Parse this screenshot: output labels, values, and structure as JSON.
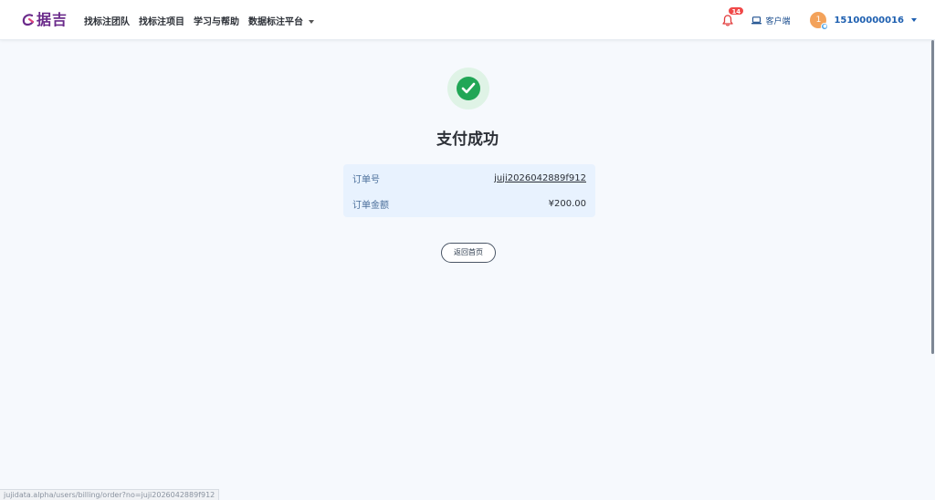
{
  "header": {
    "logo_text": "据吉",
    "nav": [
      {
        "label": "找标注团队"
      },
      {
        "label": "找标注项目"
      },
      {
        "label": "学习与帮助"
      },
      {
        "label": "数据标注平台"
      }
    ],
    "notifications_count": "14",
    "client_label": "客户端",
    "user": {
      "avatar_letter": "1",
      "phone": "15100000016"
    }
  },
  "main": {
    "title": "支付成功",
    "order": {
      "order_no_label": "订单号",
      "order_no_value": "juji2026042889f912",
      "amount_label": "订单金额",
      "amount_value": "¥200.00"
    },
    "home_button_label": "返回首页"
  },
  "status_bar": {
    "url": "jujidata.alpha/users/billing/order?no=juji2026042889f912"
  },
  "colors": {
    "brand": "#6a2a8a",
    "success": "#21a656",
    "link_blue": "#1d5fb0",
    "badge_red": "#f04848"
  }
}
